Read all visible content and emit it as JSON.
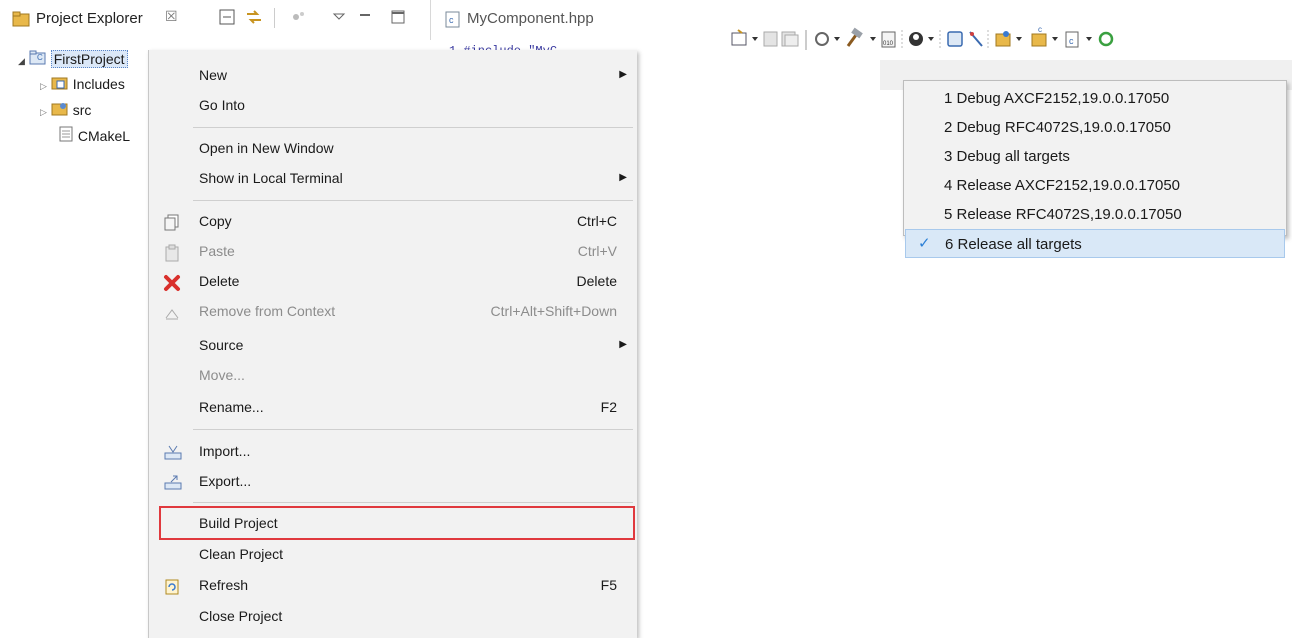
{
  "project_explorer": {
    "title": "Project Explorer",
    "close_glyph": "☒",
    "tree": [
      {
        "label": "FirstProject",
        "icon": "project-folder-icon",
        "expanded": true,
        "selected": true
      },
      {
        "label": "Includes",
        "icon": "includes-folder-icon"
      },
      {
        "label": "src",
        "icon": "source-folder-icon"
      },
      {
        "label": "CMakeL",
        "icon": "file-icon"
      }
    ]
  },
  "editor": {
    "tab_label": "MyComponent.hpp",
    "code_fragment": "1  #include \"MyC"
  },
  "context_menu": {
    "items": [
      {
        "label": "New",
        "submenu": true
      },
      {
        "label": "Go Into"
      },
      {
        "label": "Open in New Window"
      },
      {
        "label": "Show in Local Terminal",
        "submenu": true
      },
      {
        "label": "Copy",
        "shortcut": "Ctrl+C",
        "icon": "copy-icon"
      },
      {
        "label": "Paste",
        "shortcut": "Ctrl+V",
        "icon": "paste-icon",
        "disabled": true
      },
      {
        "label": "Delete",
        "shortcut": "Delete",
        "icon": "delete-icon"
      },
      {
        "label": "Remove from Context",
        "shortcut": "Ctrl+Alt+Shift+Down",
        "icon": "remove-context-icon",
        "disabled": true
      },
      {
        "label": "Source",
        "submenu": true
      },
      {
        "label": "Move...",
        "disabled": true
      },
      {
        "label": "Rename...",
        "shortcut": "F2"
      },
      {
        "label": "Import...",
        "icon": "import-icon"
      },
      {
        "label": "Export...",
        "icon": "export-icon"
      },
      {
        "label": "Build Project",
        "highlighted": true
      },
      {
        "label": "Clean Project"
      },
      {
        "label": "Refresh",
        "shortcut": "F5",
        "icon": "refresh-icon"
      },
      {
        "label": "Close Project"
      }
    ]
  },
  "build_config_menu": {
    "items": [
      {
        "label": "1 Debug AXCF2152,19.0.0.17050"
      },
      {
        "label": "2 Debug RFC4072S,19.0.0.17050"
      },
      {
        "label": "3 Debug all targets"
      },
      {
        "label": "4 Release AXCF2152,19.0.0.17050"
      },
      {
        "label": "5 Release RFC4072S,19.0.0.17050"
      },
      {
        "label": "6 Release all targets",
        "checked": true
      }
    ]
  },
  "colors": {
    "highlight_border": "#e0393e",
    "selection_bg": "#d9e8f7",
    "check": "#2b7fd6"
  }
}
